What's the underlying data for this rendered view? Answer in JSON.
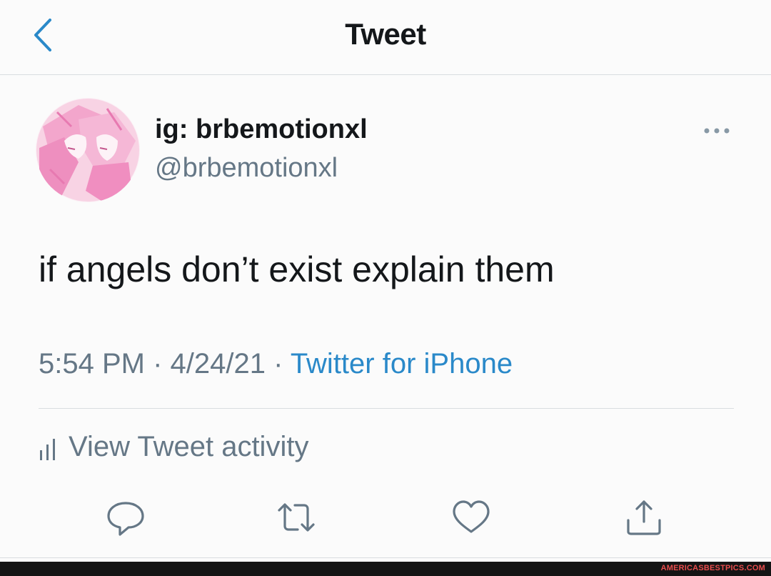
{
  "header": {
    "title": "Tweet",
    "back_icon": "chevron-left-icon"
  },
  "tweet": {
    "display_name": "ig: brbemotionxl",
    "handle": "@brbemotionxl",
    "text": "if angels don’t exist explain them",
    "time": "5:54 PM",
    "separator": " · ",
    "date": "4/24/21",
    "source": "Twitter for iPhone"
  },
  "activity": {
    "label": "View Tweet activity",
    "icon": "bar-chart-icon"
  },
  "actions": [
    {
      "name": "reply",
      "icon": "reply-icon"
    },
    {
      "name": "retweet",
      "icon": "retweet-icon"
    },
    {
      "name": "like",
      "icon": "heart-icon"
    },
    {
      "name": "share",
      "icon": "share-icon"
    }
  ],
  "colors": {
    "accent": "#2a89c9",
    "secondary_text": "#657786",
    "primary_text": "#14171a",
    "avatar_pink": "#f3a6cc"
  },
  "watermark": "AMERICASBESTPICS.COM"
}
